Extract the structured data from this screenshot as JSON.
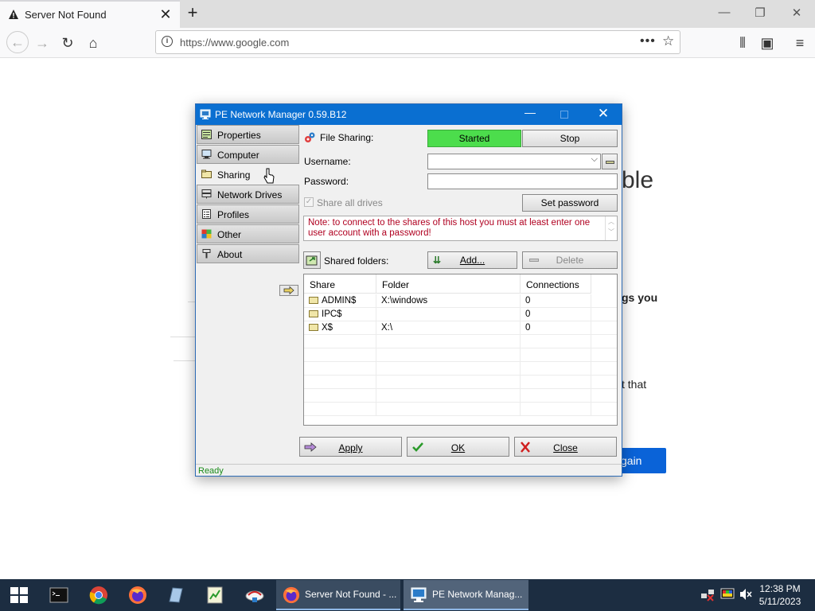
{
  "browser": {
    "tab_title": "Server Not Found",
    "url": "https://www.google.com",
    "page_fragments": {
      "heading_fragment": "ble",
      "text_fragment_1": "gs you",
      "text_fragment_2": "t that",
      "button_fragment": "gain"
    }
  },
  "dialog": {
    "title": "PE Network Manager 0.59.B12",
    "nav": [
      {
        "label": "Properties",
        "icon": "properties-icon"
      },
      {
        "label": "Computer",
        "icon": "computer-icon"
      },
      {
        "label": "Sharing",
        "icon": "sharing-icon",
        "active": true
      },
      {
        "label": "Network Drives",
        "icon": "network-drives-icon"
      },
      {
        "label": "Profiles",
        "icon": "profiles-icon"
      },
      {
        "label": "Other",
        "icon": "other-icon"
      },
      {
        "label": "About",
        "icon": "about-icon"
      }
    ],
    "sharing": {
      "file_sharing_label": "File Sharing:",
      "started_label": "Started",
      "stop_label": "Stop",
      "username_label": "Username:",
      "username_value": "",
      "password_label": "Password:",
      "password_value": "",
      "share_all_label": "Share all drives",
      "share_all_checked": true,
      "set_password_label": "Set password",
      "note": "Note: to connect to the shares of this host you must at least enter one user account with a password!",
      "shared_folders_label": "Shared folders:",
      "add_label": "Add...",
      "delete_label": "Delete",
      "columns": [
        "Share",
        "Folder",
        "Connections"
      ],
      "rows": [
        {
          "share": "ADMIN$",
          "folder": "X:\\windows",
          "connections": "0"
        },
        {
          "share": "IPC$",
          "folder": "",
          "connections": "0"
        },
        {
          "share": "X$",
          "folder": "X:\\",
          "connections": "0"
        }
      ]
    },
    "buttons": {
      "apply": "Apply",
      "ok": "OK",
      "close": "Close"
    },
    "status": "Ready"
  },
  "taskbar": {
    "apps": [
      {
        "label": "Server Not Found - ..."
      },
      {
        "label": "PE Network Manag..."
      }
    ],
    "time": "12:38 PM",
    "date": "5/11/2023"
  },
  "colors": {
    "title_bar": "#0a6fd1",
    "started": "#4cdd4c",
    "note_text": "#b00020",
    "status_text": "#1a8c1a",
    "taskbar": "#1c2d41"
  }
}
